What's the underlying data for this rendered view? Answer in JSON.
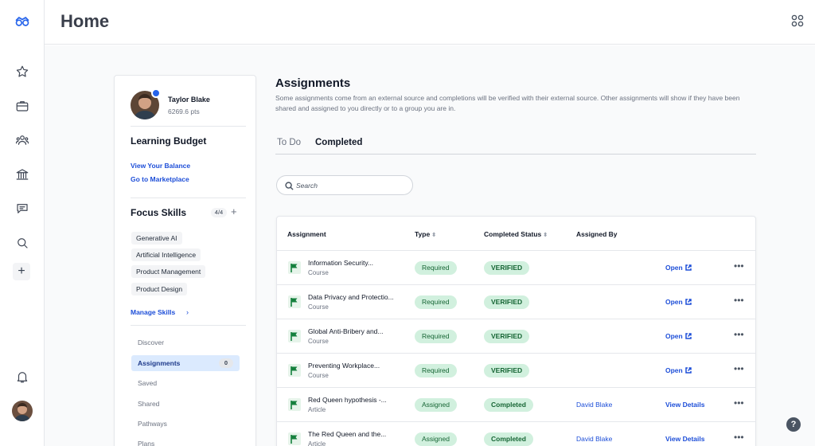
{
  "header": {
    "title": "Home"
  },
  "profile": {
    "name": "Taylor Blake",
    "points": "6269.6 pts"
  },
  "budget": {
    "title": "Learning Budget",
    "view_balance": "View Your Balance",
    "marketplace": "Go to Marketplace"
  },
  "skills": {
    "title": "Focus Skills",
    "count": "4/4",
    "add": "+",
    "items": [
      "Generative AI",
      "Artificial Intelligence",
      "Product Management",
      "Product Design"
    ],
    "manage": "Manage Skills",
    "manage_chevron": "›"
  },
  "nav": {
    "items": [
      {
        "label": "Discover"
      },
      {
        "label": "Assignments",
        "count": "0"
      },
      {
        "label": "Saved"
      },
      {
        "label": "Shared"
      },
      {
        "label": "Pathways"
      },
      {
        "label": "Plans"
      }
    ]
  },
  "assignments": {
    "title": "Assignments",
    "description": "Some assignments come from an external source and completions will be verified with their external source. Other assignments will show if they have been shared and assigned to you directly or to a group you are in.",
    "tabs": [
      "To Do",
      "Completed"
    ],
    "search_placeholder": "Search",
    "columns": {
      "assignment": "Assignment",
      "type": "Type",
      "status": "Completed Status",
      "assigned_by": "Assigned By"
    },
    "rows": [
      {
        "title": "Information Security...",
        "kind": "Course",
        "type": "Required",
        "status": "VERIFIED",
        "assigned_by": "",
        "action": "Open"
      },
      {
        "title": "Data Privacy and Protectio...",
        "kind": "Course",
        "type": "Required",
        "status": "VERIFIED",
        "assigned_by": "",
        "action": "Open"
      },
      {
        "title": "Global Anti-Bribery and...",
        "kind": "Course",
        "type": "Required",
        "status": "VERIFIED",
        "assigned_by": "",
        "action": "Open"
      },
      {
        "title": "Preventing Workplace...",
        "kind": "Course",
        "type": "Required",
        "status": "VERIFIED",
        "assigned_by": "",
        "action": "Open"
      },
      {
        "title": "Red Queen hypothesis -...",
        "kind": "Article",
        "type": "Assigned",
        "status": "Completed",
        "assigned_by": "David Blake",
        "action": "View Details"
      },
      {
        "title": "The Red Queen and the...",
        "kind": "Article",
        "type": "Assigned",
        "status": "Completed",
        "assigned_by": "David Blake",
        "action": "View Details"
      }
    ],
    "more": "•••"
  },
  "help": "?",
  "colors": {
    "accent": "#1d4ed8",
    "pill_bg": "#d1f0de",
    "pill_text": "#166534",
    "flag": "#15803d"
  }
}
